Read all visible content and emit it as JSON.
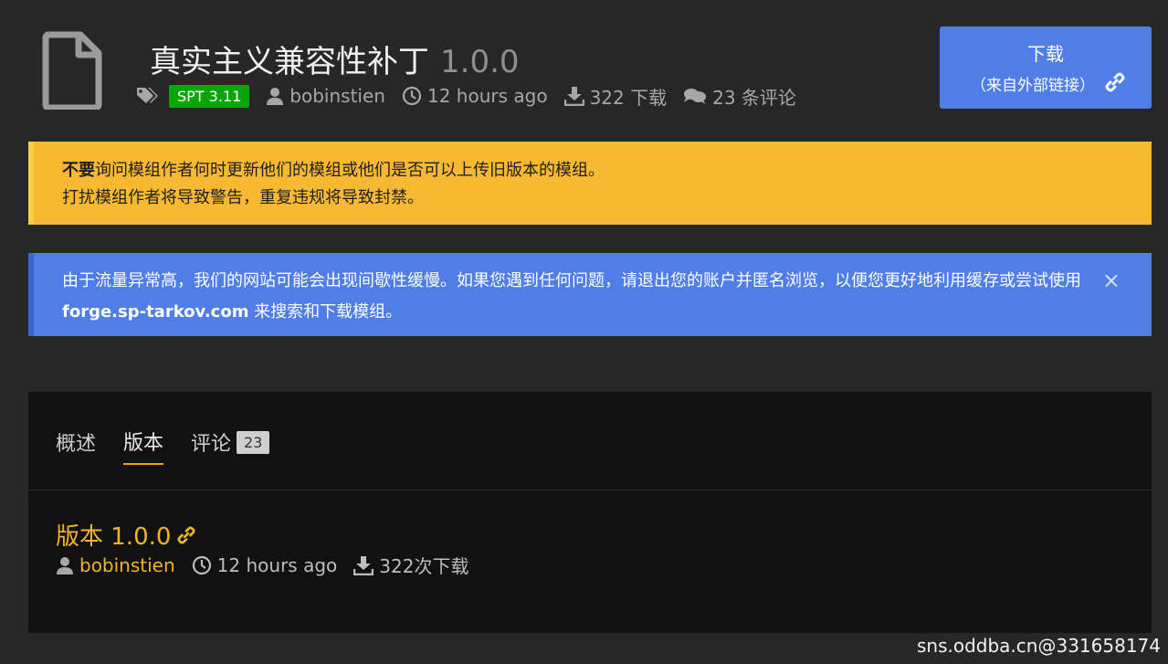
{
  "header": {
    "title": "真实主义兼容性补丁",
    "version": "1.0.0",
    "spt_badge": "SPT 3.11",
    "author": "bobinstien",
    "time": "12 hours ago",
    "downloads": "322 下载",
    "comments": "23 条评论"
  },
  "download_button": {
    "label": "下载",
    "sublabel": "（来自外部链接）"
  },
  "alerts": {
    "warning_bold": "不要",
    "warning_line1": "询问模组作者何时更新他们的模组或他们是否可以上传旧版本的模组。",
    "warning_line2": "打扰模组作者将导致警告，重复违规将导致封禁。",
    "info_text1": "由于流量异常高，我们的网站可能会出现间歇性缓慢。如果您遇到任何问题，请退出您的账户并匿名浏览，以便您更好地利用缓存或尝试使用 ",
    "info_link": "forge.sp-tarkov.com",
    "info_text2": " 来搜索和下载模组。",
    "close": "×"
  },
  "tabs": [
    {
      "label": "概述"
    },
    {
      "label": "版本"
    },
    {
      "label": "评论",
      "badge": "23"
    }
  ],
  "version_entry": {
    "title": "版本 1.0.0",
    "author": "bobinstien",
    "time": "12 hours ago",
    "downloads": "322次下载"
  },
  "watermark": "sns.oddba.cn@331658174",
  "colors": {
    "background": "#272727",
    "accent_blue": "#4f7ee6",
    "warning_yellow": "#f8b932",
    "badge_green": "#0aa50a",
    "link_gold": "#f0b429"
  }
}
